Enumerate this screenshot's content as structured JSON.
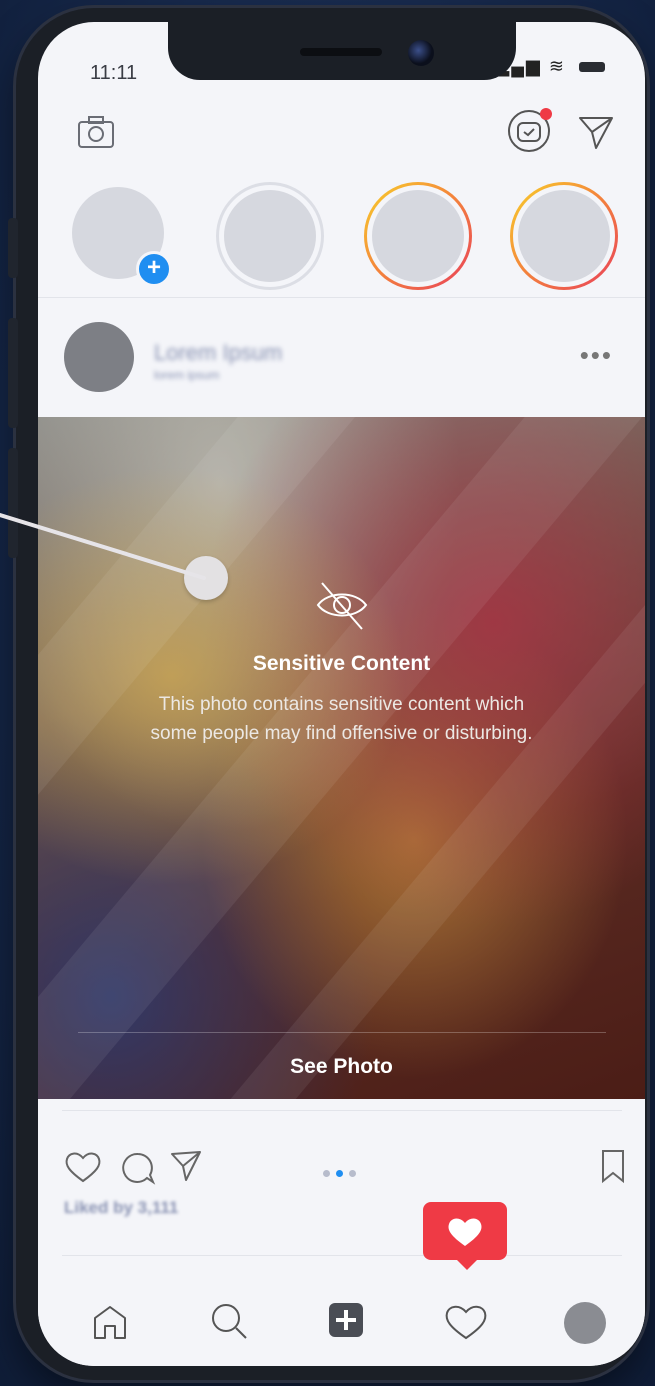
{
  "status_bar": {
    "time": "11:11"
  },
  "post": {
    "username": "Lorem Ipsum",
    "subtitle": "lorem ipsum",
    "more_label": "•••",
    "sensitive_title": "Sensitive Content",
    "sensitive_text_line1": "This photo contains sensitive content which",
    "sensitive_text_line2": "some people may find offensive or disturbing.",
    "see_photo_label": "See Photo",
    "liked_by": "Liked by 3,111",
    "pager": {
      "count": 3,
      "active_index": 1
    }
  },
  "stories": {
    "count": 4,
    "add_badge": "+"
  },
  "icons": {
    "camera": "camera-icon",
    "igtv": "igtv-icon",
    "direct": "send-icon",
    "like": "heart-icon",
    "comment": "comment-icon",
    "share": "send-icon",
    "save": "bookmark-icon",
    "home": "home-icon",
    "search": "search-icon",
    "add": "add-post-icon",
    "activity": "heart-icon",
    "profile": "profile-avatar"
  },
  "colors": {
    "story_gradient_start": "#f8d22b",
    "story_gradient_end": "#e83e5b",
    "badge_blue": "#1f8ef1",
    "notification_red": "#ef3a45",
    "background": "#17294c"
  }
}
